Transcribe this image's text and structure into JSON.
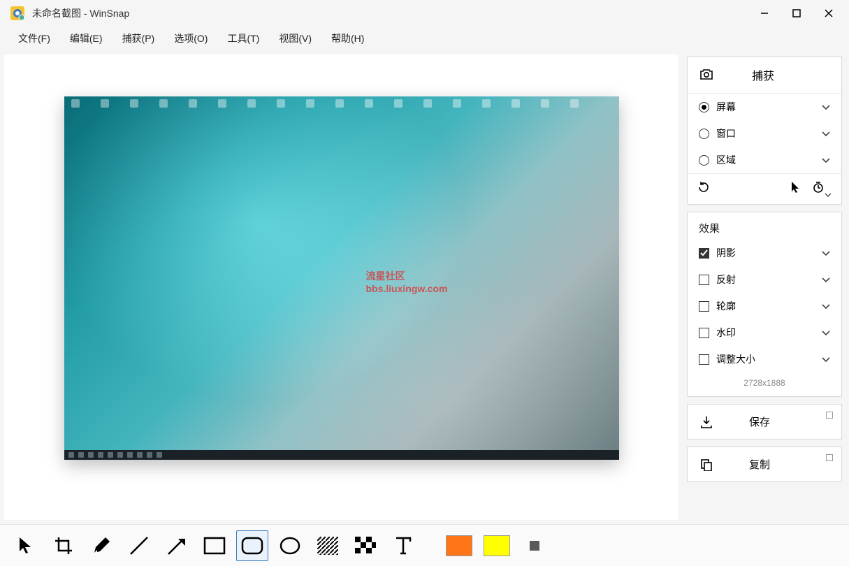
{
  "titlebar": {
    "title": "未命名截图 - WinSnap"
  },
  "menu": {
    "file": "文件(F)",
    "edit": "编辑(E)",
    "capture": "捕获(P)",
    "options": "选项(O)",
    "tools": "工具(T)",
    "view": "视图(V)",
    "help": "帮助(H)"
  },
  "watermark": {
    "line1": "流星社区",
    "line2": "bbs.liuxingw.com"
  },
  "sidebar": {
    "capture": {
      "title": "捕获",
      "screen": "屏幕",
      "window": "窗口",
      "region": "区域"
    },
    "effects": {
      "title": "效果",
      "shadow": "阴影",
      "reflection": "反射",
      "outline": "轮廓",
      "watermark": "水印",
      "resize": "调整大小",
      "dimensions": "2728x1888"
    },
    "save": "保存",
    "copy": "复制"
  }
}
